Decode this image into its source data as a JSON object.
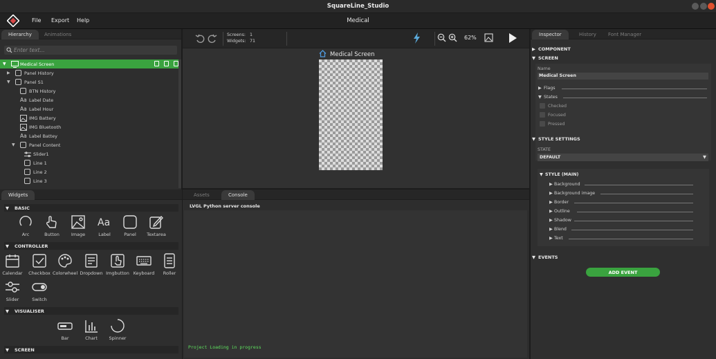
{
  "window": {
    "title": "SquareLine_Studio",
    "project_title": "Medical"
  },
  "menu": [
    "File",
    "Export",
    "Help"
  ],
  "hierarchy": {
    "tabs": [
      "Hierarchy",
      "Animations"
    ],
    "search_placeholder": "Enter text...",
    "tree": [
      {
        "label": "Medical Screen",
        "depth": 0,
        "arrow": "▼",
        "icon": "screen",
        "selected": true
      },
      {
        "label": "Panel History",
        "depth": 1,
        "arrow": "▶",
        "icon": "panel"
      },
      {
        "label": "Panel S1",
        "depth": 1,
        "arrow": "▼",
        "icon": "panel"
      },
      {
        "label": "BTN History",
        "depth": 2,
        "arrow": "",
        "icon": "panel"
      },
      {
        "label": "Label Date",
        "depth": 2,
        "arrow": "",
        "icon": "label"
      },
      {
        "label": "Label Hour",
        "depth": 2,
        "arrow": "",
        "icon": "label"
      },
      {
        "label": "IMG Battery",
        "depth": 2,
        "arrow": "",
        "icon": "image"
      },
      {
        "label": "IMG Bluetooth",
        "depth": 2,
        "arrow": "",
        "icon": "image"
      },
      {
        "label": "Label Battey",
        "depth": 2,
        "arrow": "",
        "icon": "label"
      },
      {
        "label": "Panel Content",
        "depth": 2,
        "arrow": "▼",
        "icon": "panel"
      },
      {
        "label": "Slider1",
        "depth": 3,
        "arrow": "",
        "icon": "slider"
      },
      {
        "label": "Line 1",
        "depth": 3,
        "arrow": "",
        "icon": "panel"
      },
      {
        "label": "Line 2",
        "depth": 3,
        "arrow": "",
        "icon": "panel"
      },
      {
        "label": "Line 3",
        "depth": 3,
        "arrow": "",
        "icon": "panel"
      }
    ]
  },
  "widgets": {
    "tab": "Widgets",
    "sections": {
      "basic": "BASIC",
      "controller": "CONTROLLER",
      "visualiser": "VISUALISER",
      "screen": "SCREEN"
    },
    "basic_items": [
      "Arc",
      "Button",
      "Image",
      "Label",
      "Panel",
      "Textarea"
    ],
    "controller_items": [
      "Calendar",
      "Checkbox",
      "Colorwheel",
      "Dropdown",
      "Imgbutton",
      "Keyboard",
      "Roller"
    ],
    "controller_items2": [
      "Slider",
      "Switch"
    ],
    "visualiser_items": [
      "Bar",
      "Chart",
      "Spinner"
    ]
  },
  "toolbar": {
    "screens_label": "Screens:",
    "screens_value": "1",
    "widgets_label": "Widgets:",
    "widgets_value": "71",
    "zoom": "62%"
  },
  "canvas": {
    "screen_name": "Medical Screen"
  },
  "bottom": {
    "tabs": [
      "Assets",
      "Console"
    ],
    "console_title": "LVGL Python server console",
    "console_line": "Project Loading in progress"
  },
  "inspector": {
    "tabs": [
      "Inspector",
      "History",
      "Font Manager"
    ],
    "component": "COMPONENT",
    "screen": "SCREEN",
    "name_label": "Name",
    "name_value": "Medical Screen",
    "flags": "Flags",
    "states": "States",
    "state_items": [
      "Checked",
      "Focused",
      "Pressed"
    ],
    "style_settings": "STYLE SETTINGS",
    "state_label": "STATE",
    "state_value": "DEFAULT",
    "style_main": "STYLE (MAIN)",
    "style_items": [
      "Background",
      "Background image",
      "Border",
      "Outline",
      "Shadow",
      "Blend",
      "Text"
    ],
    "events": "EVENTS",
    "add_event": "ADD EVENT"
  },
  "colors": {
    "accent_green": "#3aa33f",
    "console_green": "#5ee25e",
    "close_red": "#e0502e"
  }
}
